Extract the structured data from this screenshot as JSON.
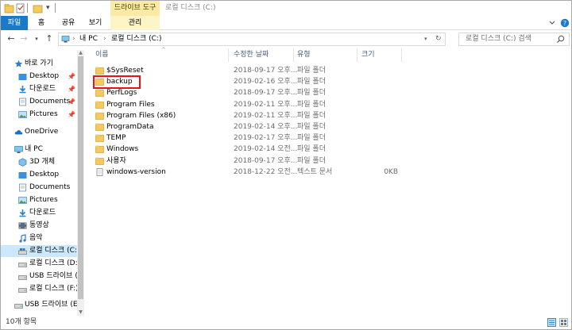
{
  "titlebar": {
    "context_tab": "드라이브 도구",
    "title": "로컬 디스크 (C:)"
  },
  "ribbon": {
    "tabs": [
      "파일",
      "홈",
      "공유",
      "보기",
      "관리"
    ]
  },
  "address": {
    "segments": [
      "내 PC",
      "로컬 디스크 (C:)"
    ],
    "search_placeholder": "로컬 디스크 (C:) 검색"
  },
  "nav": {
    "items": [
      {
        "label": "바로 가기",
        "icon": "star-icon"
      },
      {
        "label": "Desktop",
        "icon": "folder-blue-icon",
        "pinned": true
      },
      {
        "label": "다운로드",
        "icon": "download-icon",
        "pinned": true
      },
      {
        "label": "Documents",
        "icon": "documents-icon",
        "pinned": true
      },
      {
        "label": "Pictures",
        "icon": "pictures-icon",
        "pinned": true
      },
      {
        "label": "OneDrive",
        "icon": "cloud-icon"
      },
      {
        "label": "내 PC",
        "icon": "computer-icon"
      },
      {
        "label": "3D 개체",
        "icon": "cube-icon"
      },
      {
        "label": "Desktop",
        "icon": "folder-blue-icon"
      },
      {
        "label": "Documents",
        "icon": "documents-icon"
      },
      {
        "label": "Pictures",
        "icon": "pictures-icon"
      },
      {
        "label": "다운로드",
        "icon": "download-icon"
      },
      {
        "label": "동영상",
        "icon": "video-icon"
      },
      {
        "label": "음악",
        "icon": "music-icon"
      },
      {
        "label": "로컬 디스크 (C:)",
        "icon": "drive-icon",
        "selected": true
      },
      {
        "label": "로컬 디스크 (D:)",
        "icon": "drive-icon"
      },
      {
        "label": "USB 드라이브 (E",
        "icon": "usb-drive-icon"
      },
      {
        "label": "로컬 디스크 (F:)",
        "icon": "drive-icon"
      },
      {
        "label": "USB 드라이브 (E:)",
        "icon": "usb-drive-icon"
      }
    ],
    "pin_glyph": "📌"
  },
  "filelist": {
    "columns": [
      "이름",
      "수정한 날짜",
      "유형",
      "크기"
    ],
    "rows": [
      {
        "name": "$SysReset",
        "date": "2018-09-17 오후...",
        "type": "파일 폴더",
        "size": "",
        "icon": "folder-icon"
      },
      {
        "name": "backup",
        "date": "2019-02-16 오후...",
        "type": "파일 폴더",
        "size": "",
        "icon": "folder-icon"
      },
      {
        "name": "PerfLogs",
        "date": "2018-09-17 오후...",
        "type": "파일 폴더",
        "size": "",
        "icon": "folder-icon"
      },
      {
        "name": "Program Files",
        "date": "2019-02-11 오후...",
        "type": "파일 폴더",
        "size": "",
        "icon": "folder-icon"
      },
      {
        "name": "Program Files (x86)",
        "date": "2019-02-11 오후...",
        "type": "파일 폴더",
        "size": "",
        "icon": "folder-icon"
      },
      {
        "name": "ProgramData",
        "date": "2019-02-14 오후...",
        "type": "파일 폴더",
        "size": "",
        "icon": "folder-icon"
      },
      {
        "name": "TEMP",
        "date": "2019-02-17 오후...",
        "type": "파일 폴더",
        "size": "",
        "icon": "folder-icon"
      },
      {
        "name": "Windows",
        "date": "2019-02-14 오전...",
        "type": "파일 폴더",
        "size": "",
        "icon": "folder-icon"
      },
      {
        "name": "사용자",
        "date": "2018-09-17 오후...",
        "type": "파일 폴더",
        "size": "",
        "icon": "folder-icon"
      },
      {
        "name": "windows-version",
        "date": "2018-12-22 오전...",
        "type": "텍스트 문서",
        "size": "0KB",
        "icon": "text-file-icon"
      }
    ]
  },
  "status": {
    "item_count": "10개 항목"
  },
  "colors": {
    "accent": "#1979ca",
    "context_tab": "#fbeaa5",
    "selection": "#cce8ff",
    "highlight_box": "#e8121b",
    "folder": "#f4c95d"
  }
}
